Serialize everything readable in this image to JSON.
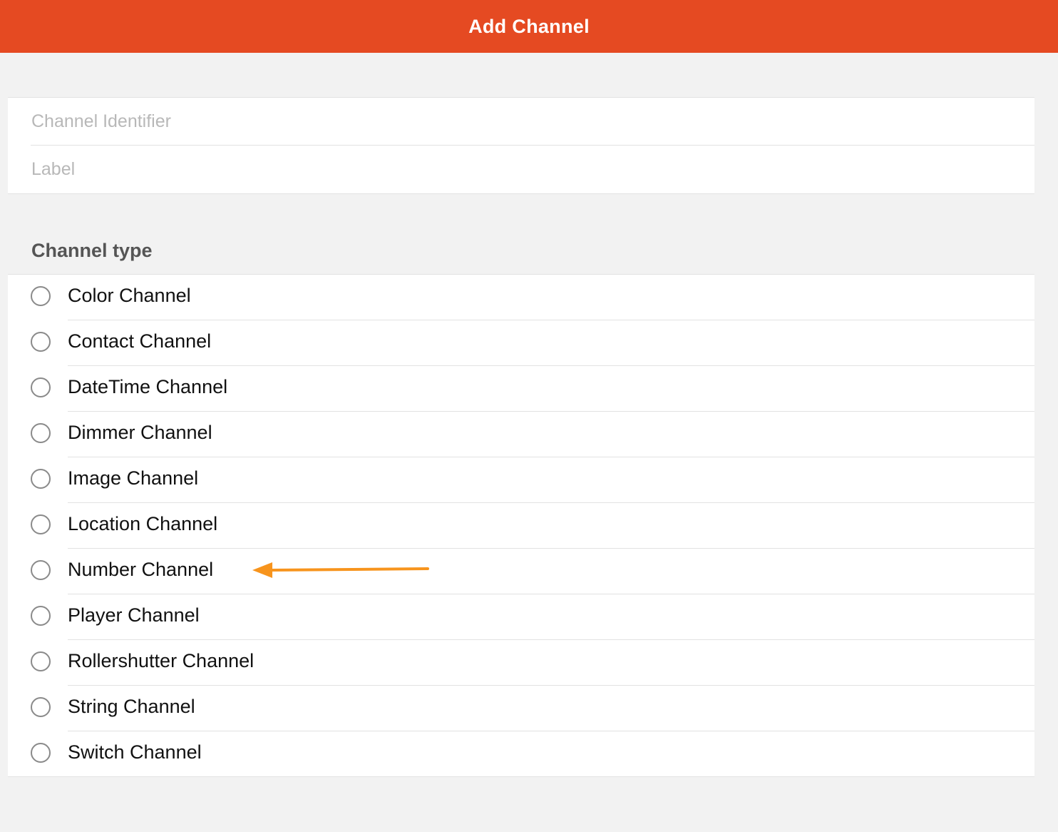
{
  "header": {
    "title": "Add Channel"
  },
  "fields": {
    "identifier_placeholder": "Channel Identifier",
    "identifier_value": "",
    "label_placeholder": "Label",
    "label_value": ""
  },
  "channel_type": {
    "title": "Channel type",
    "options": [
      {
        "label": "Color Channel",
        "selected": false
      },
      {
        "label": "Contact Channel",
        "selected": false
      },
      {
        "label": "DateTime Channel",
        "selected": false
      },
      {
        "label": "Dimmer Channel",
        "selected": false
      },
      {
        "label": "Image Channel",
        "selected": false
      },
      {
        "label": "Location Channel",
        "selected": false
      },
      {
        "label": "Number Channel",
        "selected": false
      },
      {
        "label": "Player Channel",
        "selected": false
      },
      {
        "label": "Rollershutter Channel",
        "selected": false
      },
      {
        "label": "String Channel",
        "selected": false
      },
      {
        "label": "Switch Channel",
        "selected": false
      }
    ]
  },
  "annotation": {
    "points_to": "Number Channel",
    "color": "#f7941d",
    "icon": "arrow-left-icon"
  },
  "colors": {
    "header": "#e54a22",
    "background": "#f2f2f2"
  }
}
